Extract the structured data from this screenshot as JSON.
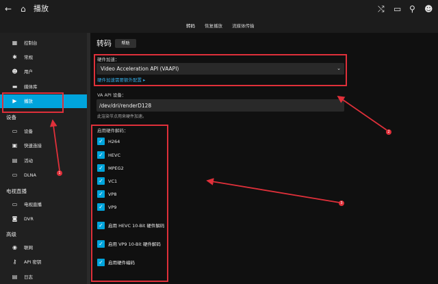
{
  "topbar": {
    "title": "播放",
    "tabs": [
      {
        "label": "转码",
        "active": true
      },
      {
        "label": "恢复播放",
        "active": false
      },
      {
        "label": "流媒体传输",
        "active": false
      }
    ]
  },
  "sidebar": {
    "items_top": [
      {
        "label": "控制台",
        "icon": "dashboard-icon",
        "glyph": "▦"
      },
      {
        "label": "常规",
        "icon": "gear-icon",
        "glyph": "✱"
      },
      {
        "label": "用户",
        "icon": "users-icon",
        "glyph": "☻"
      },
      {
        "label": "媒体库",
        "icon": "folder-icon",
        "glyph": "▬"
      },
      {
        "label": "播放",
        "icon": "play-icon",
        "glyph": "▶"
      }
    ],
    "section_devices": "设备",
    "items_devices": [
      {
        "label": "设备",
        "icon": "devices-icon",
        "glyph": "▭"
      },
      {
        "label": "快速连接",
        "icon": "quick-connect-icon",
        "glyph": "▣"
      },
      {
        "label": "活动",
        "icon": "activity-icon",
        "glyph": "▤"
      },
      {
        "label": "DLNA",
        "icon": "dlna-icon",
        "glyph": "▭"
      }
    ],
    "section_livetv": "电视直播",
    "items_livetv": [
      {
        "label": "电视直播",
        "icon": "live-tv-icon",
        "glyph": "▭"
      },
      {
        "label": "DVR",
        "icon": "dvr-icon",
        "glyph": "◙"
      }
    ],
    "section_advanced": "高级",
    "items_advanced": [
      {
        "label": "联网",
        "icon": "network-icon",
        "glyph": "◉"
      },
      {
        "label": "API 密钥",
        "icon": "key-icon",
        "glyph": "⚷"
      },
      {
        "label": "日志",
        "icon": "log-icon",
        "glyph": "▤"
      }
    ]
  },
  "main": {
    "title": "转码",
    "help_label": "帮助",
    "hw_accel_label": "硬件加速：",
    "hw_accel_value": "Video Acceleration API (VAAPI)",
    "hw_accel_link": "硬件加速需要额外配置",
    "vaapi_label": "VA API 设备：",
    "vaapi_value": "/dev/dri/renderD128",
    "vaapi_hint": "此渲染节点用来硬件加速。",
    "decode_label": "启用硬件解码：",
    "decode_options": [
      {
        "label": "H264",
        "checked": true
      },
      {
        "label": "HEVC",
        "checked": true
      },
      {
        "label": "MPEG2",
        "checked": true
      },
      {
        "label": "VC1",
        "checked": true
      },
      {
        "label": "VP8",
        "checked": true
      },
      {
        "label": "VP9",
        "checked": true
      },
      {
        "label": "启用 HEVC 10-Bit 硬件解码",
        "checked": true
      },
      {
        "label": "启用 VP9 10-Bit 硬件解码",
        "checked": true
      },
      {
        "label": "启用硬件编码",
        "checked": true
      }
    ]
  },
  "annotations": {
    "badges": [
      "1",
      "2",
      "3"
    ],
    "color": "#e0303a"
  },
  "colors": {
    "accent": "#00a4dc",
    "link": "#35a8e0",
    "background": "#101010"
  }
}
